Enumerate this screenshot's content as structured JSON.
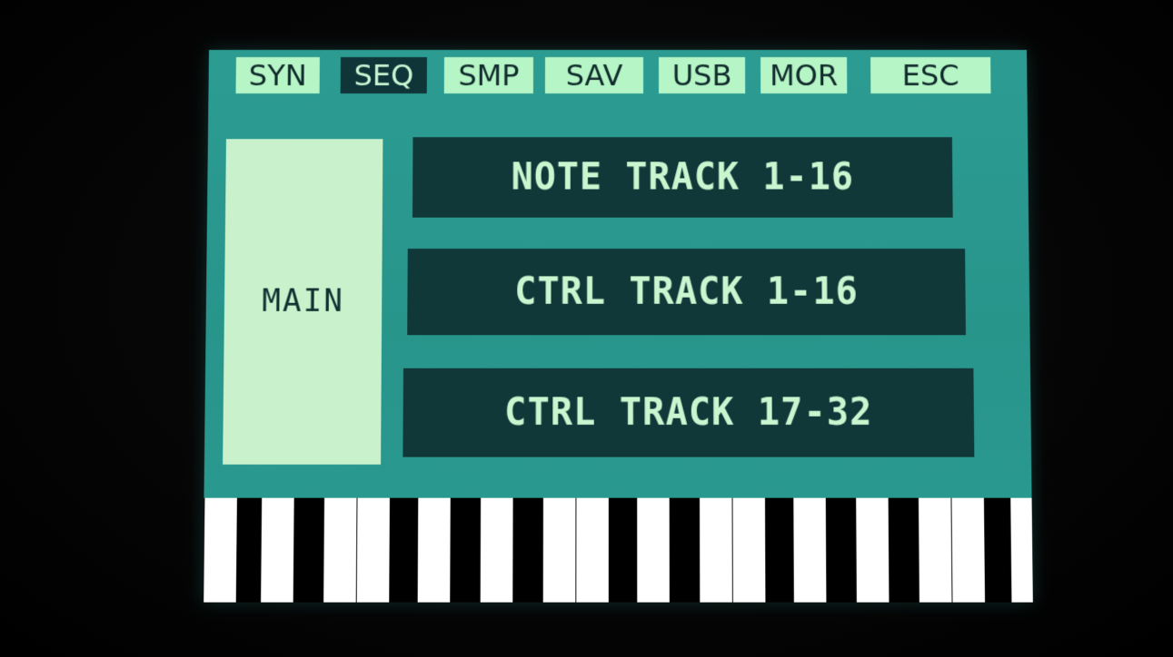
{
  "tabs": [
    {
      "label": "SYN",
      "active": false
    },
    {
      "label": "SEQ",
      "active": true
    },
    {
      "label": "SMP",
      "active": false
    },
    {
      "label": "SAV",
      "active": false
    },
    {
      "label": "USB",
      "active": false
    },
    {
      "label": "MOR",
      "active": false
    },
    {
      "label": "ESC",
      "active": false
    }
  ],
  "sidebar": {
    "label": "MAIN"
  },
  "menu": {
    "items": [
      {
        "label": "NOTE TRACK 1-16"
      },
      {
        "label": "CTRL TRACK 1-16"
      },
      {
        "label": "CTRL TRACK 17-32"
      }
    ]
  },
  "colors": {
    "screen_bg": "#2a9a90",
    "tab_bg": "#b6f5c6",
    "tab_active_bg": "#103538",
    "button_bg": "#113839",
    "button_text": "#c9f6cf",
    "sidebar_bg": "#c9f2cc"
  }
}
